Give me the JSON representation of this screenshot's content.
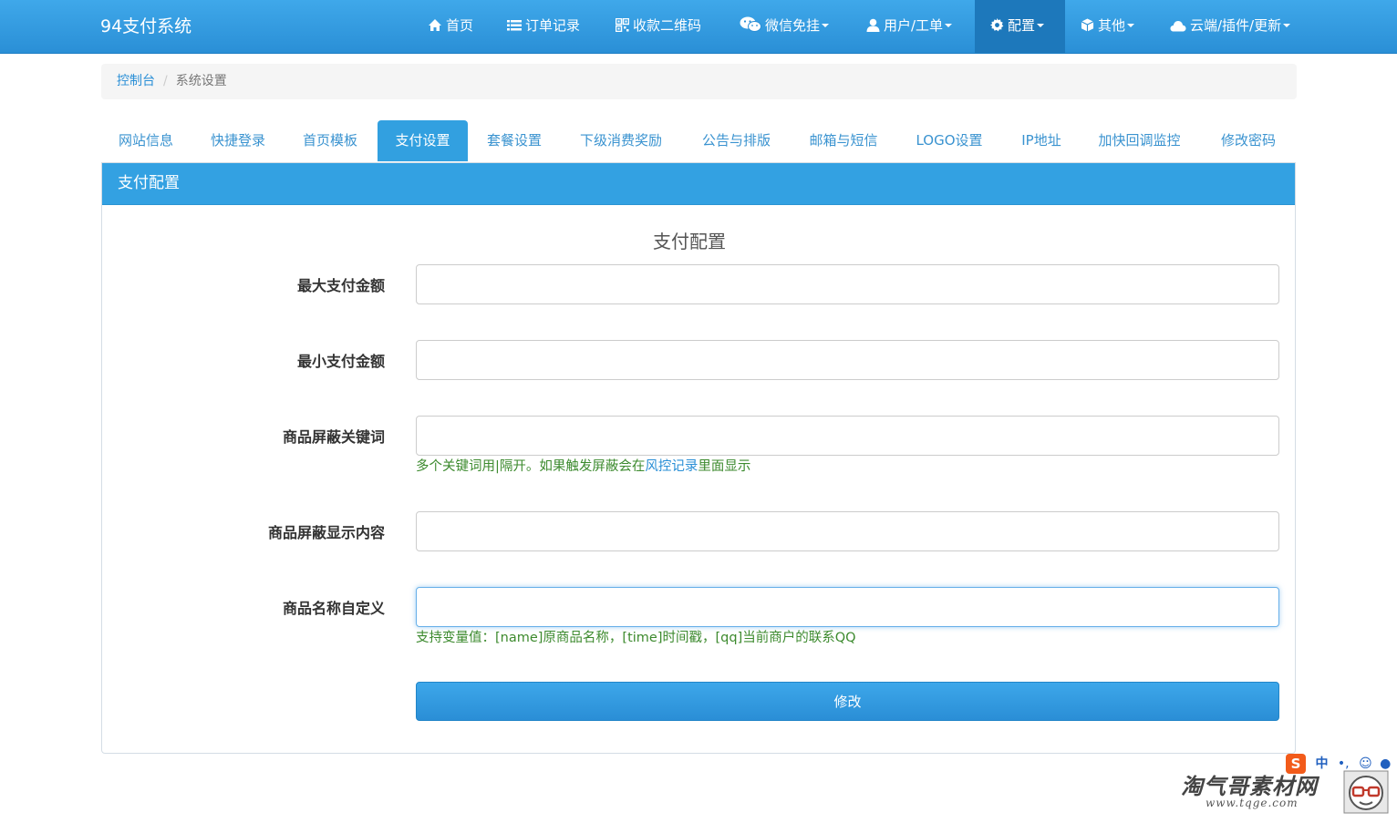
{
  "navbar": {
    "brand": "94支付系统",
    "items": [
      {
        "label": "首页",
        "icon": "home-icon",
        "dropdown": false
      },
      {
        "label": "订单记录",
        "icon": "list-icon",
        "dropdown": false
      },
      {
        "label": "收款二维码",
        "icon": "qrcode-icon",
        "dropdown": false
      },
      {
        "label": "微信免挂",
        "icon": "wechat-icon",
        "dropdown": true
      },
      {
        "label": "用户/工单",
        "icon": "user-icon",
        "dropdown": true
      },
      {
        "label": "配置",
        "icon": "gear-icon",
        "dropdown": true,
        "active": true
      },
      {
        "label": "其他",
        "icon": "cube-icon",
        "dropdown": true
      },
      {
        "label": "云端/插件/更新",
        "icon": "cloud-icon",
        "dropdown": true
      }
    ]
  },
  "breadcrumb": {
    "home": "控制台",
    "separator": "/",
    "current": "系统设置"
  },
  "tabs": [
    {
      "label": "网站信息"
    },
    {
      "label": "快捷登录"
    },
    {
      "label": "首页模板"
    },
    {
      "label": "支付设置",
      "active": true
    },
    {
      "label": "套餐设置"
    },
    {
      "label": "下级消费奖励"
    },
    {
      "label": "公告与排版"
    },
    {
      "label": "邮箱与短信"
    },
    {
      "label": "LOGO设置"
    },
    {
      "label": "IP地址"
    },
    {
      "label": "加快回调监控"
    },
    {
      "label": "修改密码"
    }
  ],
  "panel": {
    "heading": "支付配置",
    "form_title": "支付配置",
    "fields": {
      "max_amount": {
        "label": "最大支付金额",
        "value": ""
      },
      "min_amount": {
        "label": "最小支付金额",
        "value": ""
      },
      "block_keywords": {
        "label": "商品屏蔽关键词",
        "value": "",
        "help_before": "多个关键词用|隔开。如果触发屏蔽会在",
        "help_link": "风控记录",
        "help_after": "里面显示"
      },
      "block_display": {
        "label": "商品屏蔽显示内容",
        "value": ""
      },
      "custom_name": {
        "label": "商品名称自定义",
        "value": "",
        "help": "支持变量值：[name]原商品名称，[time]时间戳，[qq]当前商户的联系QQ"
      }
    },
    "submit_label": "修改"
  },
  "watermark": {
    "text": "淘气哥素材网",
    "url": "www.tqge.com",
    "ime_label": "中"
  },
  "colors": {
    "navbar": "#2a8fd6",
    "navbar_active": "#1d78bb",
    "tab_active": "#32a0e0",
    "link": "#2a8fd6",
    "help_text": "#3c8a2e"
  }
}
